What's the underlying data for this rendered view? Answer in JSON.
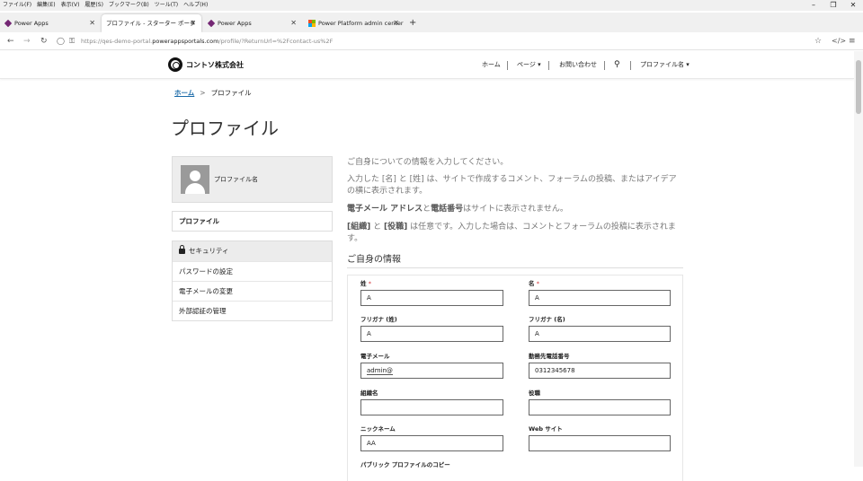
{
  "menubar": {
    "items": [
      "ファイル(F)",
      "編集(E)",
      "表示(V)",
      "履歴(S)",
      "ブックマーク(B)",
      "ツール(T)",
      "ヘルプ(H)"
    ]
  },
  "tabs": [
    {
      "label": "Power Apps",
      "icon": "power-apps-icon",
      "active": false
    },
    {
      "label": "プロファイル - スターター ポータル",
      "icon": "none",
      "active": true
    },
    {
      "label": "Power Apps",
      "icon": "power-apps-icon",
      "active": false
    },
    {
      "label": "Power Platform admin center",
      "icon": "microsoft-icon",
      "active": false
    }
  ],
  "address": {
    "url_prefix": "https://qes-demo-portal.",
    "url_domain": "powerappsportals.com",
    "url_path": "/profile/?ReturnUrl=%2Fcontact-us%2F"
  },
  "site": {
    "brand": "コントソ株式会社",
    "nav": {
      "home": "ホーム",
      "pages": "ページ",
      "contact": "お問い合わせ",
      "profile": "プロファイル名"
    }
  },
  "breadcrumb": {
    "home": "ホーム",
    "separator": ">",
    "current": "プロファイル"
  },
  "page_title": "プロファイル",
  "sidebar": {
    "profile_name": "プロファイル名",
    "profile_link": "プロファイル",
    "security_heading": "セキュリティ",
    "security_items": [
      "パスワードの設定",
      "電子メールの変更",
      "外部認証の管理"
    ]
  },
  "intro": {
    "line1": "ご自身についての情報を入力してください。",
    "line2": "入力した [名] と [姓] は、サイトで作成するコメント、フォーラムの投稿、またはアイデアの横に表示されます。",
    "line3_bold1": "電子メール アドレス",
    "line3_mid": "と",
    "line3_bold2": "電話番号",
    "line3_rest": "はサイトに表示されません。",
    "line4_b1": "[組織]",
    "line4_mid": " と ",
    "line4_b2": "[役職]",
    "line4_rest": " は任意です。入力した場合は、コメントとフォーラムの投稿に表示されます。"
  },
  "section_title": "ご自身の情報",
  "form": {
    "lastname": {
      "label": "姓",
      "value": "A"
    },
    "firstname": {
      "label": "名",
      "value": "A"
    },
    "lastname_kana": {
      "label": "フリガナ (姓)",
      "value": "A"
    },
    "firstname_kana": {
      "label": "フリガナ (名)",
      "value": "A"
    },
    "email": {
      "label": "電子メール",
      "value": "admin@"
    },
    "phone": {
      "label": "勤務先電話番号",
      "value": "0312345678"
    },
    "organization": {
      "label": "組織名",
      "value": ""
    },
    "jobtitle": {
      "label": "役職",
      "value": ""
    },
    "nickname": {
      "label": "ニックネーム",
      "value": "AA"
    },
    "website": {
      "label": "Web サイト",
      "value": ""
    },
    "public_copy_label": "パブリック プロファイルのコピー",
    "required_mark": "*"
  },
  "colors": {
    "accent": "#1a6aa8",
    "required": "#d13438",
    "power_apps": "#742774"
  }
}
